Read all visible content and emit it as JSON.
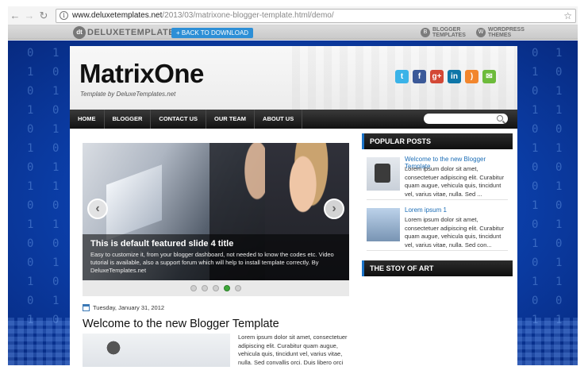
{
  "browser": {
    "url_host": "www.deluxetemplates.net",
    "url_path": "/2013/03/matrixone-blogger-template.html/demo/"
  },
  "topbar": {
    "logo_text": "DELUXETEMPLATES",
    "back_button": "+ BACK TO DOWNLOAD",
    "blogger_templates_line1": "BLOGGER",
    "blogger_templates_line2": "TEMPLATES",
    "wordpress_themes_line1": "WORDPRESS",
    "wordpress_themes_line2": "THEMES"
  },
  "background_digits": {
    "left_col_1": "0\n1\n0\n1\n0\n1\n0\n1\n0\n1\n0\n0\n1\n0\n1",
    "left_col_2": "1\n0\n1\n0\n1\n0\n1\n1\n0\n1\n0\n1\n0\n1\n0",
    "right_col_1": "0\n1\n0\n1\n0\n1\n0\n0\n1\n0\n1\n0\n1\n0\n1",
    "right_col_2": "1\n0\n1\n1\n0\n1\n0\n1\n0\n1\n0\n1\n1\n0\n1"
  },
  "header": {
    "title": "MatrixOne",
    "description": "Template by DeluxeTemplates.net"
  },
  "social_icons": [
    "twitter-icon",
    "facebook-icon",
    "google-plus-icon",
    "linkedin-icon",
    "rss-icon",
    "email-icon"
  ],
  "social_glyphs": [
    "t",
    "f",
    "g+",
    "in",
    ")",
    "✉"
  ],
  "social_colors": [
    "#3ab3e8",
    "#3b5998",
    "#d34836",
    "#0e76a8",
    "#f2862d",
    "#6dbb3b"
  ],
  "nav": {
    "items": [
      "HOME",
      "BLOGGER",
      "CONTACT US",
      "OUR TEAM",
      "ABOUT US"
    ]
  },
  "slider": {
    "caption_title": "This is default featured slide 4 title",
    "caption_text": "Easy to customize it, from your blogger dashboard, not needed to know the codes etc. Video tutorial is available, also a support forum which will help to install template correctly. By DeluxeTemplates.net",
    "active_dot": 4,
    "total_dots": 5
  },
  "post": {
    "date": "Tuesday, January 31, 2012",
    "title": "Welcome to the new Blogger Template",
    "excerpt": "Lorem ipsum dolor sit amet, consectetuer adipiscing elit. Curabitur quam augue, vehicula quis, tincidunt vel, varius vitae, nulla. Sed convallis orci. Duis libero orci"
  },
  "sidebar": {
    "popular_title": "POPULAR POSTS",
    "popular_posts": [
      {
        "title": "Welcome to the new Blogger Template",
        "text": "Lorem ipsum dolor sit amet, consectetuer adipiscing elit. Curabitur quam augue, vehicula quis, tincidunt vel, varius vitae, nulla. Sed ..."
      },
      {
        "title": "Lorem ipsum 1",
        "text": "Lorem ipsum dolor sit amet, consectetuer adipiscing elit. Curabitur quam augue, vehicula quis, tincidunt vel, varius vitae, nulla. Sed con..."
      }
    ],
    "widget2_title": "THE STOY OF ART"
  }
}
